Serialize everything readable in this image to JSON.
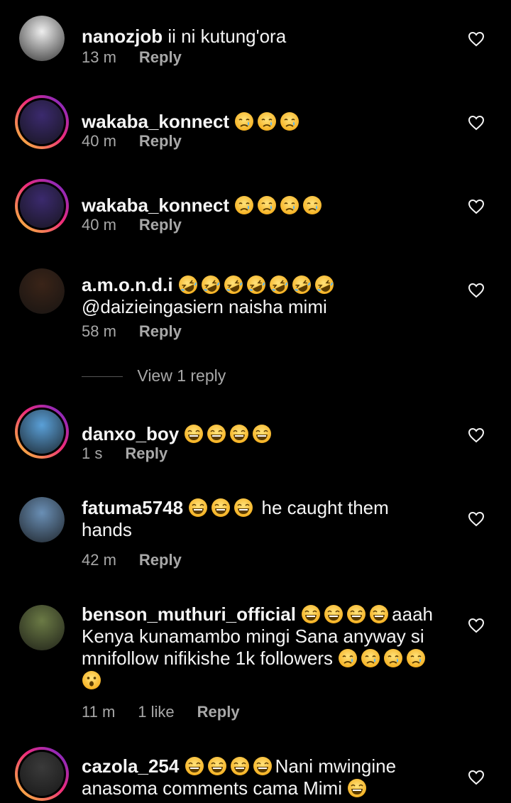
{
  "comments": [
    {
      "username": "nanozjob",
      "text": "ii ni kutung'ora",
      "text_after": "",
      "emojis": [],
      "time": "13 m",
      "likes": "",
      "reply_label": "Reply",
      "story": false,
      "avatar_color": "#eeeeee"
    },
    {
      "username": "wakaba_konnect",
      "text": "",
      "text_after": "",
      "emojis": [
        "crying",
        "crying",
        "crying"
      ],
      "time": "40 m",
      "likes": "",
      "reply_label": "Reply",
      "story": true,
      "avatar_color": "#3b2a6e"
    },
    {
      "username": "wakaba_konnect",
      "text": "",
      "text_after": "",
      "emojis": [
        "crying",
        "crying",
        "crying",
        "crying"
      ],
      "time": "40 m",
      "likes": "",
      "reply_label": "Reply",
      "story": true,
      "avatar_color": "#3b2a6e"
    },
    {
      "username": "a.m.o.n.d.i",
      "text": "",
      "text_after": "",
      "emojis": [
        "rofl",
        "rofl",
        "rofl",
        "rofl",
        "rofl",
        "rofl",
        "rofl"
      ],
      "line2": "@daizieingasiern  naisha mimi",
      "time": "58 m",
      "likes": "",
      "reply_label": "Reply",
      "story": false,
      "avatar_color": "#3a2418"
    },
    {
      "username": "danxo_boy",
      "text": "",
      "text_after": "",
      "emojis": [
        "joy",
        "joy",
        "joy",
        "joy"
      ],
      "time": "1 s",
      "likes": "",
      "reply_label": "Reply",
      "story": true,
      "avatar_color": "#5aa0d8"
    },
    {
      "username": "fatuma5748",
      "text": "",
      "emojis": [
        "joy",
        "joy",
        "joy"
      ],
      "text_after": " he caught them",
      "line2": "hands",
      "time": "42 m",
      "likes": "",
      "reply_label": "Reply",
      "story": false,
      "avatar_color": "#6a8fb5"
    },
    {
      "username": "benson_muthuri_official",
      "text": "",
      "emojis": [
        "joy",
        "joy",
        "joy",
        "joy"
      ],
      "text_after": "aaah",
      "line2": "Kenya kunamambo mingi Sana anyway si",
      "line3": "mnifollow nifikishe 1k followers",
      "line3_emojis": [
        "crying",
        "crying",
        "crying",
        "crying"
      ],
      "line4_emojis": [
        "hushed"
      ],
      "time": "11 m",
      "likes": "1 like",
      "reply_label": "Reply",
      "story": false,
      "avatar_color": "#6b7a45"
    },
    {
      "username": "cazola_254",
      "text": "",
      "emojis": [
        "joy",
        "joy",
        "joy",
        "joy"
      ],
      "text_after": "Nani mwingine",
      "line2": "anasoma comments cama Mimi",
      "line2_emojis": [
        "joy"
      ],
      "time": "",
      "likes": "",
      "reply_label": "",
      "story": true,
      "avatar_color": "#3a3a3a"
    }
  ],
  "view_replies_label": "View 1 reply",
  "colors": {
    "background": "#000000",
    "text": "#f5f5f5",
    "secondary": "#a8a8a8"
  }
}
